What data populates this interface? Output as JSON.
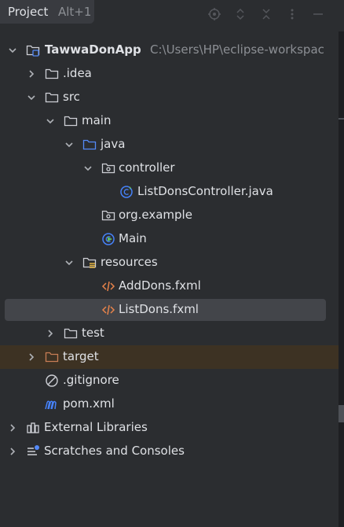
{
  "header": {
    "title": "Project",
    "shortcut": "Alt+1"
  },
  "tree": [
    {
      "label": "TawwaDonApp",
      "path": "C:\\Users\\HP\\eclipse-workspac",
      "icon": "module-folder-icon",
      "chevron": "down"
    },
    {
      "label": ".idea",
      "icon": "folder-icon",
      "chevron": "right"
    },
    {
      "label": "src",
      "icon": "folder-icon",
      "chevron": "down"
    },
    {
      "label": "main",
      "icon": "folder-icon",
      "chevron": "down"
    },
    {
      "label": "java",
      "icon": "source-folder-icon",
      "chevron": "down"
    },
    {
      "label": "controller",
      "icon": "package-icon",
      "chevron": "down"
    },
    {
      "label": "ListDonsController.java",
      "icon": "java-class-icon"
    },
    {
      "label": "org.example",
      "icon": "package-icon"
    },
    {
      "label": "Main",
      "icon": "java-class-icon"
    },
    {
      "label": "resources",
      "icon": "resources-folder-icon",
      "chevron": "down"
    },
    {
      "label": "AddDons.fxml",
      "icon": "fxml-file-icon"
    },
    {
      "label": "ListDons.fxml",
      "icon": "fxml-file-icon",
      "selected": true
    },
    {
      "label": "test",
      "icon": "folder-icon",
      "chevron": "right"
    },
    {
      "label": "target",
      "icon": "excluded-folder-icon",
      "chevron": "right"
    },
    {
      "label": ".gitignore",
      "icon": "gitignore-icon"
    },
    {
      "label": "pom.xml",
      "icon": "maven-icon"
    },
    {
      "label": "External Libraries",
      "icon": "libraries-icon",
      "chevron": "right"
    },
    {
      "label": "Scratches and Consoles",
      "icon": "scratches-icon",
      "chevron": "right"
    }
  ],
  "colors": {
    "background": "#2b2d30",
    "selection": "#43454a",
    "excluded_row": "#3d3223",
    "text": "#dfe1e5",
    "muted_text": "#8c8f94",
    "folder_blue": "#548af7",
    "excluded_orange": "#c77d55",
    "java_blue": "#4682fa",
    "fxml_orange": "#e8834a"
  }
}
